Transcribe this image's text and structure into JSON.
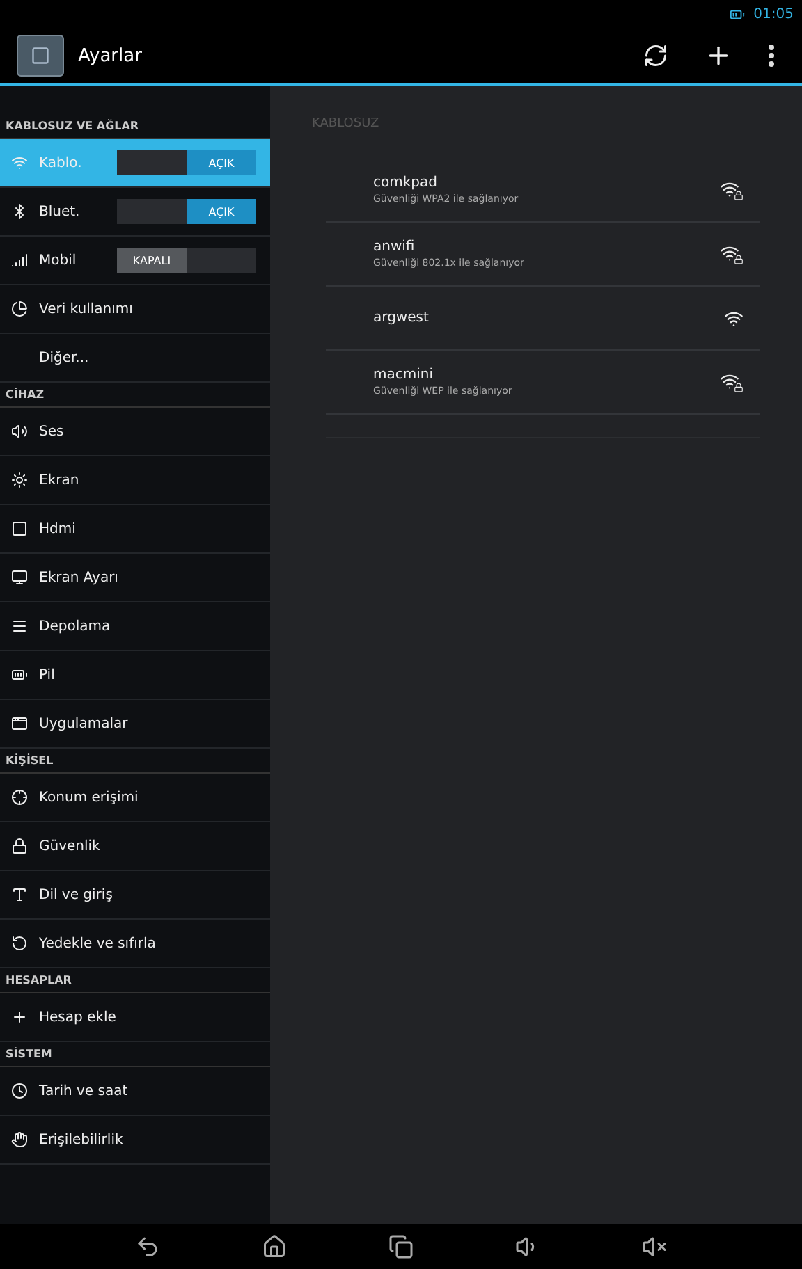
{
  "status_bar": {
    "time": "01:05"
  },
  "action_bar": {
    "title": "Ayarlar"
  },
  "sidebar": {
    "sections": [
      {
        "header": "KABLOSUZ VE AĞLAR",
        "items": [
          {
            "label": "Kablo.",
            "kind": "switch",
            "selected": true,
            "on": true,
            "switch_label": "AÇIK"
          },
          {
            "label": "Bluet.",
            "kind": "switch",
            "selected": false,
            "on": true,
            "switch_label": "AÇIK"
          },
          {
            "label": "Mobil",
            "kind": "switch",
            "selected": false,
            "on": false,
            "switch_label": "KAPALI"
          },
          {
            "label": "Veri kullanımı",
            "kind": "plain",
            "selected": false
          },
          {
            "label": "Diğer...",
            "kind": "noicon",
            "selected": false
          }
        ]
      },
      {
        "header": "CİHAZ",
        "items": [
          {
            "label": "Ses",
            "kind": "plain",
            "selected": false
          },
          {
            "label": "Ekran",
            "kind": "plain",
            "selected": false
          },
          {
            "label": "Hdmi",
            "kind": "plain",
            "selected": false
          },
          {
            "label": "Ekran Ayarı",
            "kind": "plain",
            "selected": false
          },
          {
            "label": "Depolama",
            "kind": "plain",
            "selected": false
          },
          {
            "label": "Pil",
            "kind": "plain",
            "selected": false
          },
          {
            "label": "Uygulamalar",
            "kind": "plain",
            "selected": false
          }
        ]
      },
      {
        "header": "KİŞİSEL",
        "items": [
          {
            "label": "Konum erişimi",
            "kind": "plain",
            "selected": false
          },
          {
            "label": "Güvenlik",
            "kind": "plain",
            "selected": false
          },
          {
            "label": "Dil ve giriş",
            "kind": "plain",
            "selected": false
          },
          {
            "label": "Yedekle ve sıfırla",
            "kind": "plain",
            "selected": false
          }
        ]
      },
      {
        "header": "HESAPLAR",
        "items": [
          {
            "label": "Hesap ekle",
            "kind": "plain",
            "selected": false
          }
        ]
      },
      {
        "header": "SİSTEM",
        "items": [
          {
            "label": "Tarih ve saat",
            "kind": "plain",
            "selected": false
          },
          {
            "label": "Erişilebilirlik",
            "kind": "plain",
            "selected": false
          }
        ]
      }
    ]
  },
  "content": {
    "header": "KABLOSUZ",
    "networks": [
      {
        "name": "comkpad",
        "summary": "Güvenliği WPA2 ile sağlanıyor",
        "secured": true
      },
      {
        "name": "anwifi",
        "summary": "Güvenliği 802.1x ile sağlanıyor",
        "secured": true
      },
      {
        "name": "argwest",
        "secured": false
      },
      {
        "name": "macmini",
        "summary": "Güvenliği WEP ile sağlanıyor",
        "secured": true
      }
    ]
  }
}
